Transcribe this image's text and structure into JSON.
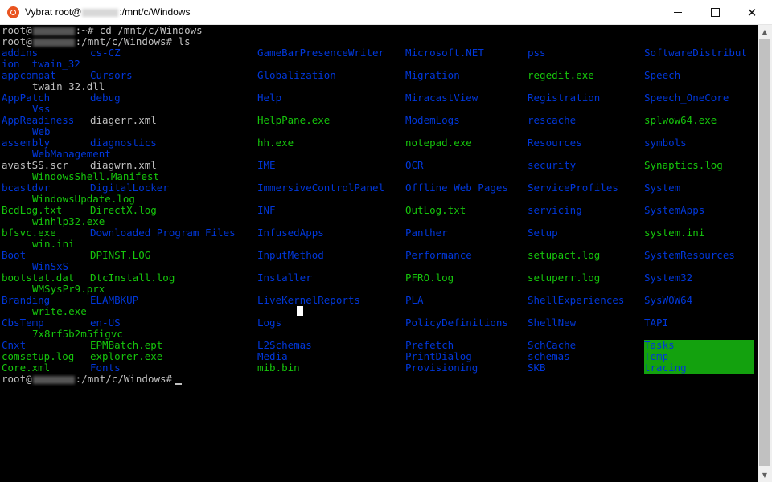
{
  "window": {
    "title_prefix": "Vybrat root@",
    "title_suffix": ":/mnt/c/Windows",
    "controls": {
      "minimize": "",
      "maximize": "",
      "close": "✕"
    }
  },
  "terminal": {
    "prompt_user": "root@",
    "cmd1": ":~# cd /mnt/c/Windows",
    "cmd2": ":/mnt/c/Windows# ls",
    "final_prompt": ":/mnt/c/Windows#",
    "listing": [
      {
        "t": "addins",
        "c": "dir",
        "col": 0,
        "row": 0
      },
      {
        "t": "cs-CZ",
        "c": "dir",
        "col": 1,
        "row": 0
      },
      {
        "t": "GameBarPresenceWriter",
        "c": "dir",
        "col": 2,
        "row": 0
      },
      {
        "t": "Microsoft.NET",
        "c": "dir",
        "col": 3,
        "row": 0
      },
      {
        "t": "pss",
        "c": "dir",
        "col": 4,
        "row": 0
      },
      {
        "t": "SoftwareDistribut",
        "c": "dir",
        "col": 5,
        "row": 0
      },
      {
        "t": "ion  twain_32",
        "c": "dir",
        "col": "w0",
        "row": 1
      },
      {
        "t": "appcompat",
        "c": "dir",
        "col": 0,
        "row": 2
      },
      {
        "t": "Cursors",
        "c": "dir",
        "col": 1,
        "row": 2
      },
      {
        "t": "Globalization",
        "c": "dir",
        "col": 2,
        "row": 2
      },
      {
        "t": "Migration",
        "c": "dir",
        "col": 3,
        "row": 2
      },
      {
        "t": "regedit.exe",
        "c": "exe",
        "col": 4,
        "row": 2
      },
      {
        "t": "Speech",
        "c": "dir",
        "col": 5,
        "row": 2
      },
      {
        "t": "twain_32.dll",
        "c": "file",
        "col": "w",
        "row": 3
      },
      {
        "t": "AppPatch",
        "c": "dir",
        "col": 0,
        "row": 4
      },
      {
        "t": "debug",
        "c": "dir",
        "col": 1,
        "row": 4
      },
      {
        "t": "Help",
        "c": "dir",
        "col": 2,
        "row": 4
      },
      {
        "t": "MiracastView",
        "c": "dir",
        "col": 3,
        "row": 4
      },
      {
        "t": "Registration",
        "c": "dir",
        "col": 4,
        "row": 4
      },
      {
        "t": "Speech_OneCore",
        "c": "dir",
        "col": 5,
        "row": 4
      },
      {
        "t": "Vss",
        "c": "dir",
        "col": "w",
        "row": 5
      },
      {
        "t": "AppReadiness",
        "c": "dir",
        "col": 0,
        "row": 6
      },
      {
        "t": "diagerr.xml",
        "c": "file",
        "col": 1,
        "row": 6
      },
      {
        "t": "HelpPane.exe",
        "c": "exe",
        "col": 2,
        "row": 6
      },
      {
        "t": "ModemLogs",
        "c": "dir",
        "col": 3,
        "row": 6
      },
      {
        "t": "rescache",
        "c": "dir",
        "col": 4,
        "row": 6
      },
      {
        "t": "splwow64.exe",
        "c": "exe",
        "col": 5,
        "row": 6
      },
      {
        "t": "Web",
        "c": "dir",
        "col": "w",
        "row": 7
      },
      {
        "t": "assembly",
        "c": "dir",
        "col": 0,
        "row": 8
      },
      {
        "t": "diagnostics",
        "c": "dir",
        "col": 1,
        "row": 8
      },
      {
        "t": "hh.exe",
        "c": "exe",
        "col": 2,
        "row": 8
      },
      {
        "t": "notepad.exe",
        "c": "exe",
        "col": 3,
        "row": 8
      },
      {
        "t": "Resources",
        "c": "dir",
        "col": 4,
        "row": 8
      },
      {
        "t": "symbols",
        "c": "dir",
        "col": 5,
        "row": 8
      },
      {
        "t": "WebManagement",
        "c": "dir",
        "col": "w",
        "row": 9
      },
      {
        "t": "avastSS.scr",
        "c": "file",
        "col": 0,
        "row": 10
      },
      {
        "t": "diagwrn.xml",
        "c": "file",
        "col": 1,
        "row": 10
      },
      {
        "t": "IME",
        "c": "dir",
        "col": 2,
        "row": 10
      },
      {
        "t": "OCR",
        "c": "dir",
        "col": 3,
        "row": 10
      },
      {
        "t": "security",
        "c": "dir",
        "col": 4,
        "row": 10
      },
      {
        "t": "Synaptics.log",
        "c": "exe",
        "col": 5,
        "row": 10
      },
      {
        "t": "WindowsShell.Manifest",
        "c": "exe",
        "col": "w",
        "row": 11
      },
      {
        "t": "bcastdvr",
        "c": "dir",
        "col": 0,
        "row": 12
      },
      {
        "t": "DigitalLocker",
        "c": "dir",
        "col": 1,
        "row": 12
      },
      {
        "t": "ImmersiveControlPanel",
        "c": "dir",
        "col": 2,
        "row": 12
      },
      {
        "t": "Offline Web Pages",
        "c": "dir",
        "col": 3,
        "row": 12
      },
      {
        "t": "ServiceProfiles",
        "c": "dir",
        "col": 4,
        "row": 12
      },
      {
        "t": "System",
        "c": "dir",
        "col": 5,
        "row": 12
      },
      {
        "t": "WindowsUpdate.log",
        "c": "exe",
        "col": "w",
        "row": 13
      },
      {
        "t": "BcdLog.txt",
        "c": "exe",
        "col": 0,
        "row": 14
      },
      {
        "t": "DirectX.log",
        "c": "exe",
        "col": 1,
        "row": 14
      },
      {
        "t": "INF",
        "c": "dir",
        "col": 2,
        "row": 14
      },
      {
        "t": "OutLog.txt",
        "c": "exe",
        "col": 3,
        "row": 14
      },
      {
        "t": "servicing",
        "c": "dir",
        "col": 4,
        "row": 14
      },
      {
        "t": "SystemApps",
        "c": "dir",
        "col": 5,
        "row": 14
      },
      {
        "t": "winhlp32.exe",
        "c": "exe",
        "col": "w",
        "row": 15
      },
      {
        "t": "bfsvc.exe",
        "c": "exe",
        "col": 0,
        "row": 16
      },
      {
        "t": "Downloaded Program Files",
        "c": "dir",
        "col": 1,
        "row": 16
      },
      {
        "t": "InfusedApps",
        "c": "dir",
        "col": 2,
        "row": 16
      },
      {
        "t": "Panther",
        "c": "dir",
        "col": 3,
        "row": 16
      },
      {
        "t": "Setup",
        "c": "dir",
        "col": 4,
        "row": 16
      },
      {
        "t": "system.ini",
        "c": "exe",
        "col": 5,
        "row": 16
      },
      {
        "t": "win.ini",
        "c": "exe",
        "col": "w",
        "row": 17
      },
      {
        "t": "Boot",
        "c": "dir",
        "col": 0,
        "row": 18
      },
      {
        "t": "DPINST.LOG",
        "c": "exe",
        "col": 1,
        "row": 18
      },
      {
        "t": "InputMethod",
        "c": "dir",
        "col": 2,
        "row": 18
      },
      {
        "t": "Performance",
        "c": "dir",
        "col": 3,
        "row": 18
      },
      {
        "t": "setupact.log",
        "c": "exe",
        "col": 4,
        "row": 18
      },
      {
        "t": "SystemResources",
        "c": "dir",
        "col": 5,
        "row": 18
      },
      {
        "t": "WinSxS",
        "c": "dir",
        "col": "w",
        "row": 19
      },
      {
        "t": "bootstat.dat",
        "c": "exe",
        "col": 0,
        "row": 20
      },
      {
        "t": "DtcInstall.log",
        "c": "exe",
        "col": 1,
        "row": 20
      },
      {
        "t": "Installer",
        "c": "dir",
        "col": 2,
        "row": 20
      },
      {
        "t": "PFRO.log",
        "c": "exe",
        "col": 3,
        "row": 20
      },
      {
        "t": "setuperr.log",
        "c": "exe",
        "col": 4,
        "row": 20
      },
      {
        "t": "System32",
        "c": "dir",
        "col": 5,
        "row": 20
      },
      {
        "t": "WMSysPr9.prx",
        "c": "exe",
        "col": "w",
        "row": 21
      },
      {
        "t": "Branding",
        "c": "dir",
        "col": 0,
        "row": 22
      },
      {
        "t": "ELAMBKUP",
        "c": "dir",
        "col": 1,
        "row": 22
      },
      {
        "t": "LiveKernelReports",
        "c": "dir",
        "col": 2,
        "row": 22
      },
      {
        "t": "PLA",
        "c": "dir",
        "col": 3,
        "row": 22
      },
      {
        "t": "ShellExperiences",
        "c": "dir",
        "col": 4,
        "row": 22
      },
      {
        "t": "SysWOW64",
        "c": "dir",
        "col": 5,
        "row": 22
      },
      {
        "t": "write.exe",
        "c": "exe",
        "col": "w",
        "row": 23
      },
      {
        "t": "CbsTemp",
        "c": "dir",
        "col": 0,
        "row": 24
      },
      {
        "t": "en-US",
        "c": "dir",
        "col": 1,
        "row": 24
      },
      {
        "t": "Logs",
        "c": "dir",
        "col": 2,
        "row": 24
      },
      {
        "t": "PolicyDefinitions",
        "c": "dir",
        "col": 3,
        "row": 24
      },
      {
        "t": "ShellNew",
        "c": "dir",
        "col": 4,
        "row": 24
      },
      {
        "t": "TAPI",
        "c": "dir",
        "col": 5,
        "row": 24
      },
      {
        "t": "7x8rf5b2m5figvc",
        "c": "exe",
        "col": "w",
        "row": 25
      },
      {
        "t": "Cnxt",
        "c": "dir",
        "col": 0,
        "row": 26
      },
      {
        "t": "EPMBatch.ept",
        "c": "exe",
        "col": 1,
        "row": 26
      },
      {
        "t": "L2Schemas",
        "c": "dir",
        "col": 2,
        "row": 26
      },
      {
        "t": "Prefetch",
        "c": "dir",
        "col": 3,
        "row": 26
      },
      {
        "t": "SchCache",
        "c": "dir",
        "col": 4,
        "row": 26
      },
      {
        "t": "Tasks",
        "c": "hl",
        "col": 5,
        "row": 26
      },
      {
        "t": "comsetup.log",
        "c": "exe",
        "col": 0,
        "row": 27
      },
      {
        "t": "explorer.exe",
        "c": "exe",
        "col": 1,
        "row": 27
      },
      {
        "t": "Media",
        "c": "dir",
        "col": 2,
        "row": 27
      },
      {
        "t": "PrintDialog",
        "c": "dir",
        "col": 3,
        "row": 27
      },
      {
        "t": "schemas",
        "c": "dir",
        "col": 4,
        "row": 27
      },
      {
        "t": "Temp",
        "c": "hl",
        "col": 5,
        "row": 27
      },
      {
        "t": "Core.xml",
        "c": "exe",
        "col": 0,
        "row": 28
      },
      {
        "t": "Fonts",
        "c": "dir",
        "col": 1,
        "row": 28
      },
      {
        "t": "mib.bin",
        "c": "exe",
        "col": 2,
        "row": 28
      },
      {
        "t": "Provisioning",
        "c": "dir",
        "col": 3,
        "row": 28
      },
      {
        "t": "SKB",
        "c": "dir",
        "col": 4,
        "row": 28
      },
      {
        "t": "tracing",
        "c": "hl",
        "col": 5,
        "row": 28
      }
    ]
  },
  "colors": {
    "background": "#000000",
    "directory": "#0037da",
    "file": "#c0c0c0",
    "executable": "#16c60c",
    "highlight": "#13a10e"
  }
}
